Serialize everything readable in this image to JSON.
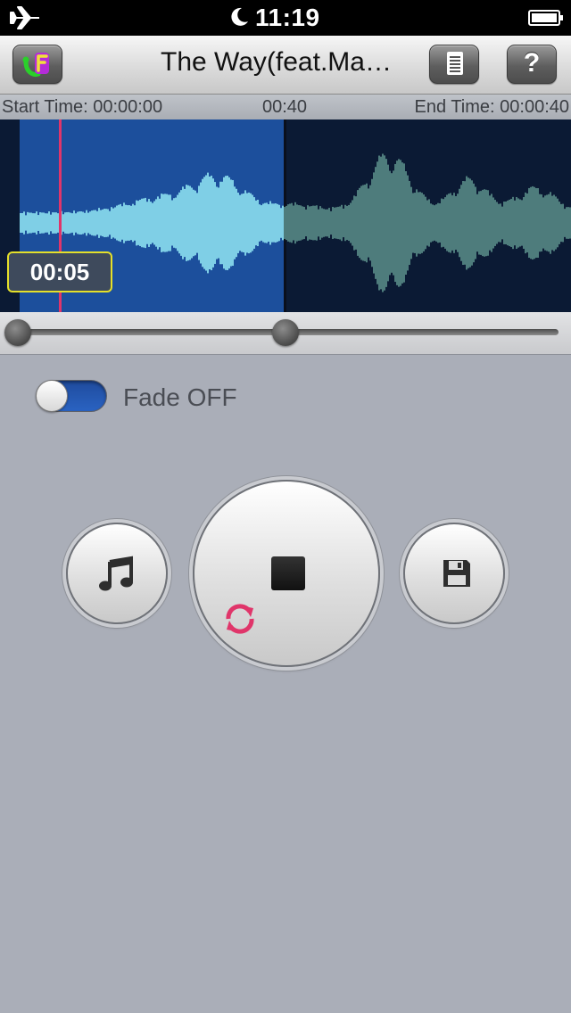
{
  "status_bar": {
    "time": "11:19",
    "icons": [
      "airplane-icon",
      "moon-icon",
      "battery-icon"
    ]
  },
  "nav": {
    "title": "The Way(feat.Ma…",
    "app_icon": "app-logo-icon",
    "list_icon": "list-icon",
    "help_label": "?"
  },
  "time_row": {
    "start": "Start Time: 00:00:00",
    "mid": "00:40",
    "end": "End Time: 00:00:40"
  },
  "waveform": {
    "playhead_label": "00:05",
    "colors": {
      "selected_bg": "#1c4f9c",
      "selected_wave": "#7fcfe6",
      "unselected_wave": "#4e7c7c",
      "playhead": "#e0356a"
    }
  },
  "fade": {
    "label": "Fade OFF",
    "state": "off"
  },
  "controls": {
    "music_icon": "music-note-icon",
    "stop_icon": "stop-icon",
    "loop_icon": "loop-icon",
    "save_icon": "floppy-disk-icon"
  },
  "colors": {
    "accent": "#2a63c2",
    "loop": "#e0356a",
    "background": "#aaaeb8"
  }
}
